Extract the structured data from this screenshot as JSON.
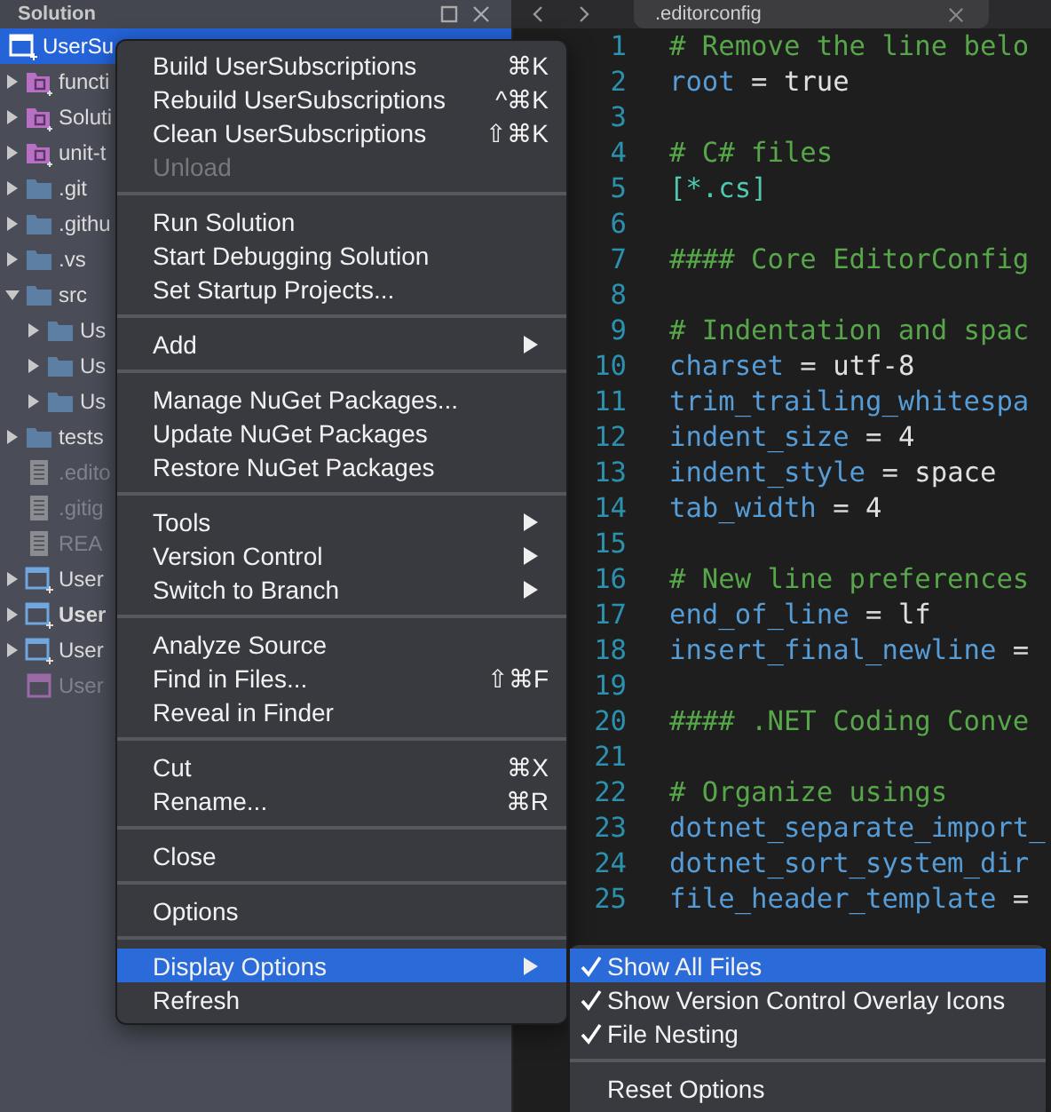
{
  "solution_pad": {
    "title": "Solution",
    "root": {
      "label": "UserSu",
      "kind": "solution",
      "selected": true,
      "children": [
        {
          "label": "functi",
          "kind": "project-folder",
          "selected": false,
          "expanded": false,
          "bold": false,
          "dimmed": false
        },
        {
          "label": "Soluti",
          "kind": "project-folder",
          "selected": false,
          "expanded": false,
          "bold": false,
          "dimmed": false
        },
        {
          "label": "unit-t",
          "kind": "project-folder",
          "selected": false,
          "expanded": false,
          "bold": false,
          "dimmed": false
        },
        {
          "label": ".git",
          "kind": "folder",
          "selected": false,
          "expanded": false,
          "bold": false,
          "dimmed": false
        },
        {
          "label": ".githu",
          "kind": "folder",
          "selected": false,
          "expanded": false,
          "bold": false,
          "dimmed": false
        },
        {
          "label": ".vs",
          "kind": "folder",
          "selected": false,
          "expanded": false,
          "bold": false,
          "dimmed": false
        },
        {
          "label": "src",
          "kind": "folder",
          "selected": false,
          "expanded": true,
          "bold": false,
          "dimmed": false,
          "children": [
            {
              "label": "Us",
              "kind": "folder",
              "selected": false,
              "expanded": false,
              "bold": false,
              "dimmed": false
            },
            {
              "label": "Us",
              "kind": "folder",
              "selected": false,
              "expanded": false,
              "bold": false,
              "dimmed": false
            },
            {
              "label": "Us",
              "kind": "folder",
              "selected": false,
              "expanded": false,
              "bold": false,
              "dimmed": false
            }
          ]
        },
        {
          "label": "tests",
          "kind": "folder",
          "selected": false,
          "expanded": false,
          "bold": false,
          "dimmed": false
        },
        {
          "label": ".edito",
          "kind": "file",
          "selected": false,
          "bold": false,
          "dimmed": true
        },
        {
          "label": ".gitig",
          "kind": "file",
          "selected": false,
          "bold": false,
          "dimmed": true
        },
        {
          "label": "REA",
          "kind": "file",
          "selected": false,
          "bold": false,
          "dimmed": true
        },
        {
          "label": "User",
          "kind": "project",
          "selected": false,
          "expanded": false,
          "bold": false,
          "dimmed": false
        },
        {
          "label": "User",
          "kind": "project",
          "selected": false,
          "expanded": false,
          "bold": true,
          "dimmed": false
        },
        {
          "label": "User",
          "kind": "project",
          "selected": false,
          "expanded": false,
          "bold": false,
          "dimmed": false
        },
        {
          "label": "User",
          "kind": "shared-project",
          "selected": false,
          "bold": false,
          "dimmed": true
        }
      ]
    }
  },
  "editor": {
    "tab": {
      "title": ".editorconfig",
      "selected": true
    },
    "lines": [
      {
        "number": "1",
        "tokens": [
          {
            "kind": "comment",
            "text": "# Remove the line belo"
          }
        ]
      },
      {
        "number": "2",
        "tokens": [
          {
            "kind": "key",
            "text": "root"
          },
          {
            "kind": "op",
            "text": " = "
          },
          {
            "kind": "value",
            "text": "true"
          }
        ]
      },
      {
        "number": "3"
      },
      {
        "number": "4",
        "tokens": [
          {
            "kind": "comment",
            "text": "# C# files"
          }
        ]
      },
      {
        "number": "5",
        "tokens": [
          {
            "kind": "section",
            "text": "[*.cs]"
          }
        ]
      },
      {
        "number": "6"
      },
      {
        "number": "7",
        "tokens": [
          {
            "kind": "comment",
            "text": "#### Core EditorConfig"
          }
        ]
      },
      {
        "number": "8"
      },
      {
        "number": "9",
        "tokens": [
          {
            "kind": "comment",
            "text": "# Indentation and spac"
          }
        ]
      },
      {
        "number": "10",
        "tokens": [
          {
            "kind": "key",
            "text": "charset"
          },
          {
            "kind": "op",
            "text": " = "
          },
          {
            "kind": "value",
            "text": "utf-8"
          }
        ]
      },
      {
        "number": "11",
        "tokens": [
          {
            "kind": "key",
            "text": "trim_trailing_whitespa"
          }
        ]
      },
      {
        "number": "12",
        "tokens": [
          {
            "kind": "key",
            "text": "indent_size"
          },
          {
            "kind": "op",
            "text": " = "
          },
          {
            "kind": "value",
            "text": "4"
          }
        ]
      },
      {
        "number": "13",
        "tokens": [
          {
            "kind": "key",
            "text": "indent_style"
          },
          {
            "kind": "op",
            "text": " = "
          },
          {
            "kind": "value",
            "text": "space"
          }
        ]
      },
      {
        "number": "14",
        "tokens": [
          {
            "kind": "key",
            "text": "tab_width"
          },
          {
            "kind": "op",
            "text": " = "
          },
          {
            "kind": "value",
            "text": "4"
          }
        ]
      },
      {
        "number": "15"
      },
      {
        "number": "16",
        "tokens": [
          {
            "kind": "comment",
            "text": "# New line preferences"
          }
        ]
      },
      {
        "number": "17",
        "tokens": [
          {
            "kind": "key",
            "text": "end_of_line"
          },
          {
            "kind": "op",
            "text": " = "
          },
          {
            "kind": "value",
            "text": "lf"
          }
        ]
      },
      {
        "number": "18",
        "tokens": [
          {
            "kind": "key",
            "text": "insert_final_newline"
          },
          {
            "kind": "op",
            "text": " ="
          }
        ]
      },
      {
        "number": "19"
      },
      {
        "number": "20",
        "tokens": [
          {
            "kind": "comment",
            "text": "#### .NET Coding Conve"
          }
        ]
      },
      {
        "number": "21"
      },
      {
        "number": "22",
        "tokens": [
          {
            "kind": "comment",
            "text": "# Organize usings"
          }
        ]
      },
      {
        "number": "23",
        "tokens": [
          {
            "kind": "key",
            "text": "dotnet_separate_import_"
          }
        ]
      },
      {
        "number": "24",
        "tokens": [
          {
            "kind": "key",
            "text": "dotnet_sort_system_dir"
          }
        ]
      },
      {
        "number": "25",
        "tokens": [
          {
            "kind": "key",
            "text": "file_header_template"
          },
          {
            "kind": "op",
            "text": " ="
          }
        ]
      }
    ]
  },
  "context_menu": {
    "groups": [
      [
        {
          "label": "Build UserSubscriptions",
          "shortcut": "⌘K",
          "has_submenu": false,
          "disabled": false,
          "selected": false
        },
        {
          "label": "Rebuild UserSubscriptions",
          "shortcut": "^⌘K",
          "has_submenu": false,
          "disabled": false,
          "selected": false
        },
        {
          "label": "Clean UserSubscriptions",
          "shortcut": "⇧⌘K",
          "has_submenu": false,
          "disabled": false,
          "selected": false
        },
        {
          "label": "Unload",
          "has_submenu": false,
          "disabled": true,
          "selected": false
        }
      ],
      [
        {
          "label": "Run Solution",
          "has_submenu": false,
          "disabled": false,
          "selected": false
        },
        {
          "label": "Start Debugging Solution",
          "has_submenu": false,
          "disabled": false,
          "selected": false
        },
        {
          "label": "Set Startup Projects...",
          "has_submenu": false,
          "disabled": false,
          "selected": false
        }
      ],
      [
        {
          "label": "Add",
          "has_submenu": true,
          "disabled": false,
          "selected": false
        }
      ],
      [
        {
          "label": "Manage NuGet Packages...",
          "has_submenu": false,
          "disabled": false,
          "selected": false
        },
        {
          "label": "Update NuGet Packages",
          "has_submenu": false,
          "disabled": false,
          "selected": false
        },
        {
          "label": "Restore NuGet Packages",
          "has_submenu": false,
          "disabled": false,
          "selected": false
        }
      ],
      [
        {
          "label": "Tools",
          "has_submenu": true,
          "disabled": false,
          "selected": false
        },
        {
          "label": "Version Control",
          "has_submenu": true,
          "disabled": false,
          "selected": false
        },
        {
          "label": "Switch to Branch",
          "has_submenu": true,
          "disabled": false,
          "selected": false
        }
      ],
      [
        {
          "label": "Analyze Source",
          "has_submenu": false,
          "disabled": false,
          "selected": false
        },
        {
          "label": "Find in Files...",
          "shortcut": "⇧⌘F",
          "has_submenu": false,
          "disabled": false,
          "selected": false
        },
        {
          "label": "Reveal in Finder",
          "has_submenu": false,
          "disabled": false,
          "selected": false
        }
      ],
      [
        {
          "label": "Cut",
          "shortcut": "⌘X",
          "has_submenu": false,
          "disabled": false,
          "selected": false
        },
        {
          "label": "Rename...",
          "shortcut": "⌘R",
          "has_submenu": false,
          "disabled": false,
          "selected": false
        }
      ],
      [
        {
          "label": "Close",
          "has_submenu": false,
          "disabled": false,
          "selected": false
        }
      ],
      [
        {
          "label": "Options",
          "has_submenu": false,
          "disabled": false,
          "selected": false
        }
      ],
      [
        {
          "label": "Display Options",
          "has_submenu": true,
          "disabled": false,
          "selected": true
        },
        {
          "label": "Refresh",
          "has_submenu": false,
          "disabled": false,
          "selected": false
        }
      ]
    ]
  },
  "submenu": {
    "groups": [
      [
        {
          "label": "Show All Files",
          "checked": true,
          "selected": true
        },
        {
          "label": "Show Version Control Overlay Icons",
          "checked": true,
          "selected": false
        },
        {
          "label": "File Nesting",
          "checked": true,
          "selected": false
        }
      ],
      [
        {
          "label": "Reset Options",
          "checked": false,
          "selected": false
        }
      ]
    ]
  }
}
